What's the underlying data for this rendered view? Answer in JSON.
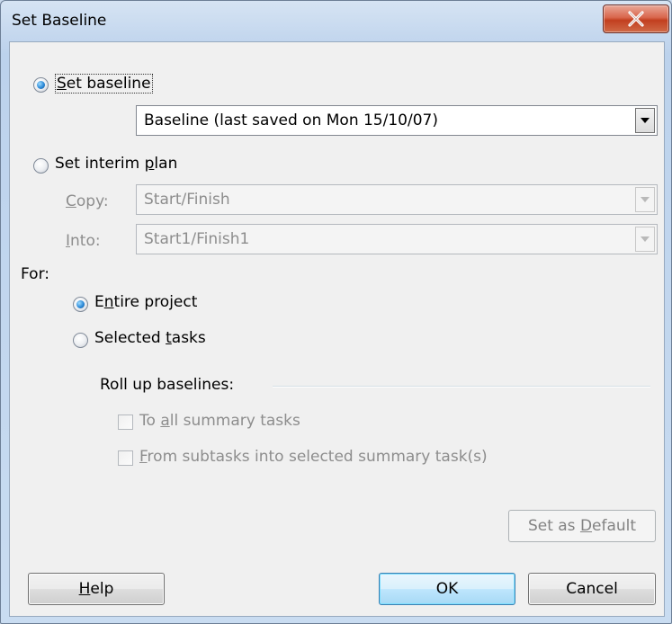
{
  "window": {
    "title": "Set Baseline"
  },
  "set_baseline": {
    "label_prefix": "S",
    "label_rest": "et baseline",
    "checked": true,
    "dropdown_value": "Baseline (last saved on Mon 15/10/07)"
  },
  "interim": {
    "label_prefix": "Set interim ",
    "label_ul": "p",
    "label_rest": "lan",
    "checked": false,
    "copy": {
      "label_ul": "C",
      "label_rest": "opy:",
      "value": "Start/Finish"
    },
    "into": {
      "label_ul": "I",
      "label_rest": "nto:",
      "value": "Start1/Finish1"
    }
  },
  "for": {
    "label": "For:",
    "entire_project": {
      "pre": "E",
      "ul": "n",
      "rest": "tire project",
      "checked": true
    },
    "selected_tasks": {
      "pre": "Selected ",
      "ul": "t",
      "rest": "asks",
      "checked": false
    }
  },
  "rollup": {
    "label": "Roll up baselines:",
    "to_all": {
      "pre": "To ",
      "ul": "a",
      "rest": "ll summary tasks"
    },
    "from_subtasks": {
      "ul": "F",
      "rest": "rom subtasks into selected summary task(s)"
    }
  },
  "buttons": {
    "set_default": {
      "pre": "Set as ",
      "ul": "D",
      "rest": "efault"
    },
    "help": {
      "ul": "H",
      "rest": "elp"
    },
    "ok": "OK",
    "cancel": "Cancel"
  }
}
